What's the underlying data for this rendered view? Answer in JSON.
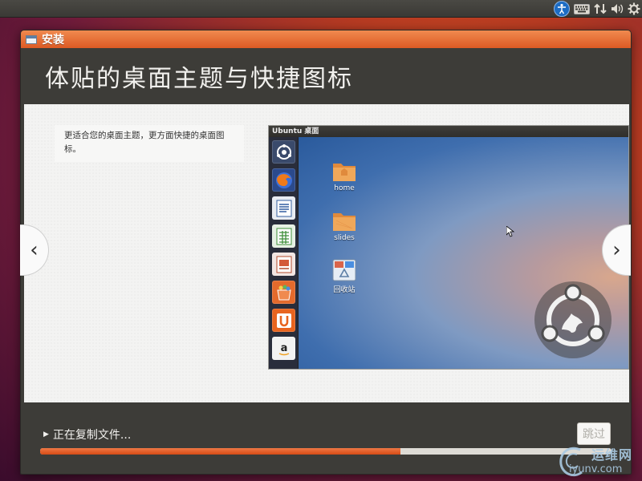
{
  "top_panel": {
    "icons": [
      "accessibility-icon",
      "keyboard-icon",
      "network-icon",
      "volume-icon",
      "gear-icon"
    ]
  },
  "window": {
    "title": "安装",
    "slide_title": "体贴的桌面主题与快捷图标",
    "description": "更适合您的桌面主题，更方面快捷的桌面图标。",
    "screenshot": {
      "bar_title": "Ubuntu 桌面",
      "launcher_icons": [
        "dash-icon",
        "firefox-icon",
        "writer-icon",
        "calc-icon",
        "impress-icon",
        "software-center-icon",
        "ubuntu-one-icon",
        "amazon-icon"
      ],
      "desktop_items": [
        {
          "label": "home",
          "icon": "folder-icon"
        },
        {
          "label": "slides",
          "icon": "folder-icon"
        },
        {
          "label": "回收站",
          "icon": "trash-icon"
        }
      ]
    },
    "nav": {
      "prev": "‹",
      "next": "›"
    },
    "footer": {
      "status": "正在复制文件...",
      "skip_label": "跳过",
      "progress": 0.63
    }
  },
  "watermark": {
    "text": "运维网",
    "url": "iyunv.com"
  },
  "colors": {
    "titlebar": "#e0632b",
    "progress": "#e0632b",
    "panel": "#3d3c38"
  }
}
